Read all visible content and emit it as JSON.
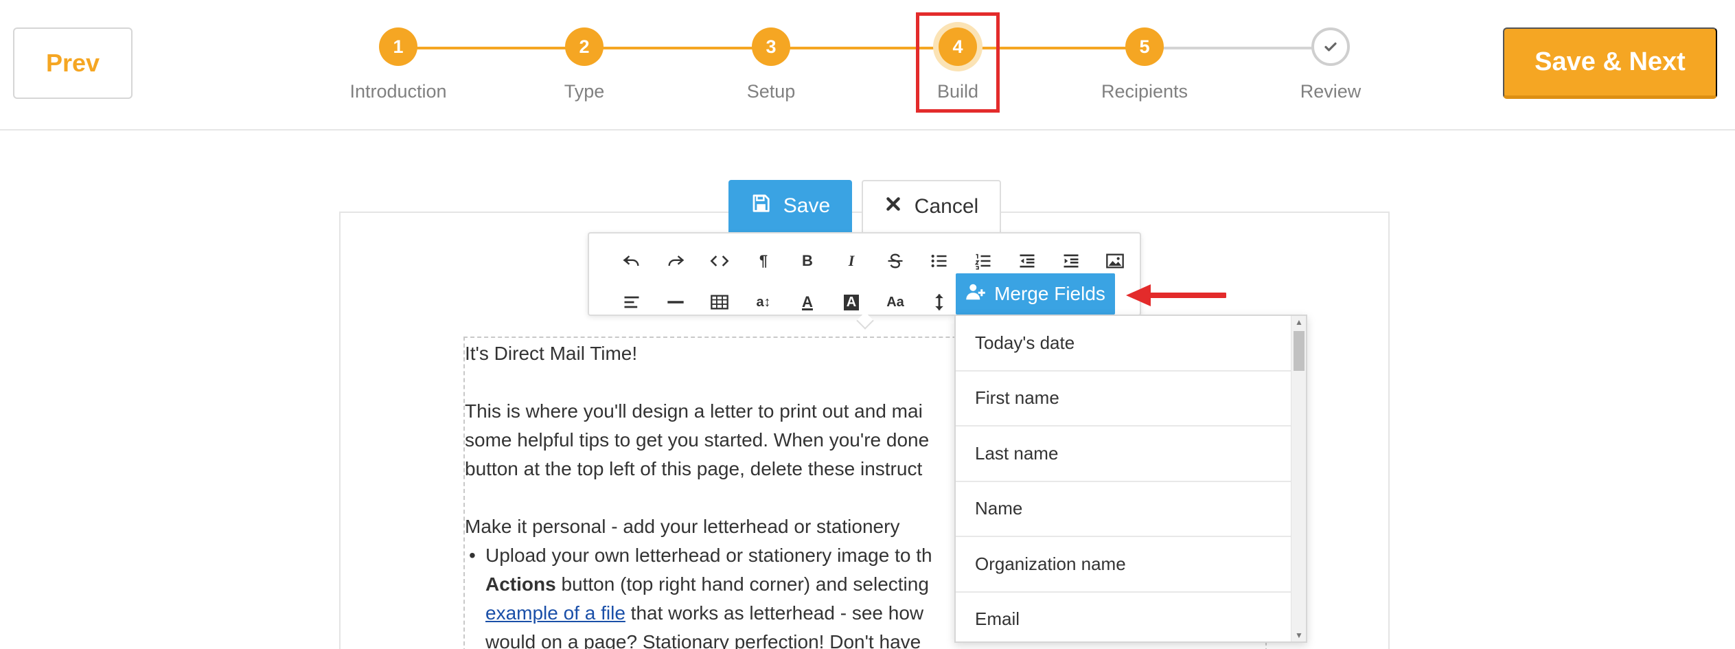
{
  "nav": {
    "prev_label": "Prev",
    "next_label": "Save & Next",
    "accent_color": "#f5a623",
    "steps": [
      {
        "number": "1",
        "label": "Introduction",
        "state": "done"
      },
      {
        "number": "2",
        "label": "Type",
        "state": "done"
      },
      {
        "number": "3",
        "label": "Setup",
        "state": "done"
      },
      {
        "number": "4",
        "label": "Build",
        "state": "current"
      },
      {
        "number": "5",
        "label": "Recipients",
        "state": "done"
      },
      {
        "number": "",
        "label": "Review",
        "state": "pending",
        "icon": "checkmark-icon"
      }
    ]
  },
  "editor": {
    "save_label": "Save",
    "cancel_label": "Cancel",
    "save_color": "#3aa3e3",
    "merge_fields_label": "Merge Fields",
    "toolbar_row1": [
      "undo-icon",
      "redo-icon",
      "code-view-icon",
      "paragraph-icon",
      "bold-icon",
      "italic-icon",
      "strikethrough-icon",
      "bullet-list-icon",
      "numbered-list-icon",
      "outdent-icon",
      "indent-icon",
      "image-icon"
    ],
    "toolbar_row2": [
      "align-left-icon",
      "horizontal-rule-icon",
      "table-icon",
      "font-size-icon",
      "font-color-icon",
      "background-color-icon",
      "text-case-icon",
      "line-height-icon"
    ],
    "text_glyphs": {
      "bold": "B",
      "italic": "I",
      "font_size": "a↕",
      "font_color": "A",
      "bg_color": "A",
      "text_case": "Aa",
      "paragraph": "¶"
    }
  },
  "document": {
    "heading": "It's Direct Mail Time!",
    "para1_line1": "This is where you'll design a letter to print out and mai",
    "para1_line2": "some helpful tips to get you started. When you're done",
    "para1_line3": "button at the top left of this page, delete these instruct",
    "section_title": "Make it personal - add your letterhead or stationery",
    "bullet_line1": "Upload your own letterhead or stationery image to th",
    "bullet_line2_bold": "Actions",
    "bullet_line2_rest": " button (top right hand corner) and selecting",
    "bullet_line3_link": "example of a file",
    "bullet_line3_rest": " that works as letterhead - see how",
    "bullet_line4": "would on a page? Stationary perfection! Don't have"
  },
  "merge_fields": {
    "items": [
      "Today's date",
      "First name",
      "Last name",
      "Name",
      "Organization name",
      "Email"
    ]
  },
  "annotation": {
    "highlight_color": "#e32b2b"
  }
}
